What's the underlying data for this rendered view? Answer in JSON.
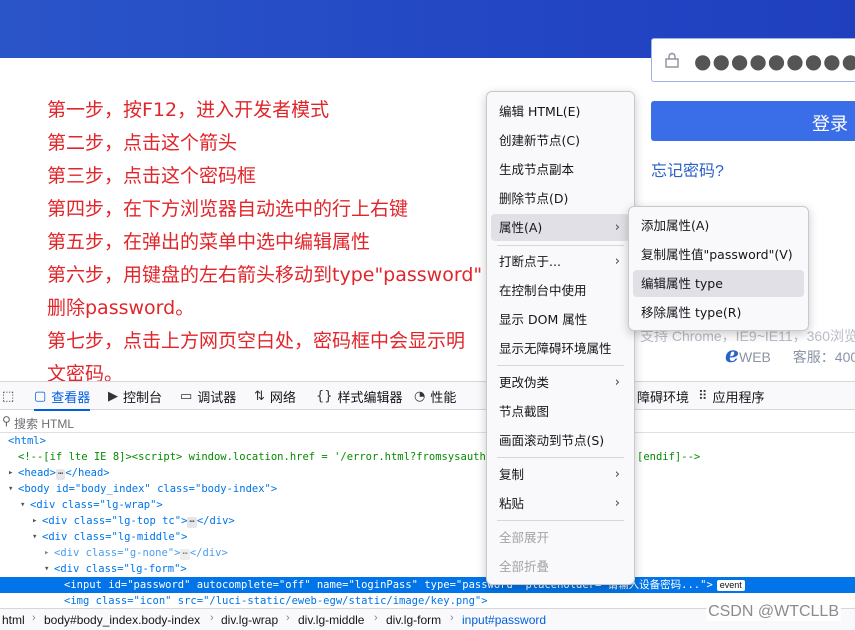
{
  "page": {
    "password_dots": "●●●●●●●●●●",
    "login_label": "登录",
    "forgot_label": "忘记密码?",
    "steps": [
      "第一步，按F12，进入开发者模式",
      "第二步，点击这个箭头",
      "第三步，点击这个密码框",
      "第四步，在下方浏览器自动选中的行上右键",
      "第五步，在弹出的菜单中选中编辑属性",
      "第六步，用键盘的左右箭头移动到type\"password\"",
      "删除password。",
      "第七步，点击上方网页空白处，密码框中会显示明",
      "文密码。"
    ],
    "support_text": "支持 Chrome，IE9~IE11，360浏览",
    "eweb_logo": "e",
    "eweb_text": "WEB",
    "service_text": "客服：",
    "service_num": "400"
  },
  "devtools": {
    "tabs": [
      {
        "icon": "▢",
        "label": "查看器"
      },
      {
        "icon": "▶",
        "label": "控制台"
      },
      {
        "icon": "▭",
        "label": "调试器"
      },
      {
        "icon": "⇅",
        "label": "网络"
      },
      {
        "icon": "{}",
        "label": "样式编辑器"
      },
      {
        "icon": "◔",
        "label": "性能"
      },
      {
        "icon": "",
        "label": "障碍环境"
      },
      {
        "icon": "⠿",
        "label": "应用程序"
      }
    ],
    "search_placeholder": "搜索 HTML",
    "tree": [
      "<html>",
      "<!--[if lte IE 8]><script> window.location.href = '/error.html?fromsysauth' + ",
      "[endif]-->",
      "<head>",
      "</head>",
      "<body id=\"body_index\" class=\"body-index\">",
      "<div class=\"lg-wrap\">",
      "<div class=\"lg-top tc\">",
      "</div>",
      "<div class=\"lg-middle\">",
      "<div class=\"g-none\">",
      "</div>",
      "<div class=\"lg-form\">",
      "<input id=\"password\" autocomplete=\"off\" name=\"loginPass\" type=\"password\" placeholder=\"请输入设备密码...\">",
      "event",
      "<img class=\"icon\" src=\"/luci-static/eweb-egw/static/image/key.png\">"
    ],
    "breadcrumb": [
      "html",
      "body#body_index.body-index",
      "div.lg-wrap",
      "div.lg-middle",
      "div.lg-form",
      "input#password"
    ]
  },
  "context_menu": {
    "items": [
      "编辑 HTML(E)",
      "创建新节点(C)",
      "生成节点副本",
      "删除节点(D)",
      "属性(A)",
      "打断点于...",
      "在控制台中使用",
      "显示 DOM 属性",
      "显示无障碍环境属性",
      "更改伪类",
      "节点截图",
      "画面滚动到节点(S)",
      "复制",
      "粘贴",
      "全部展开",
      "全部折叠"
    ]
  },
  "submenu": {
    "items": [
      "添加属性(A)",
      "复制属性值\"password\"(V)",
      "编辑属性 type",
      "移除属性 type(R)"
    ]
  },
  "watermark": "CSDN @WTCLLB",
  "colors": {
    "banner": "#2346c4",
    "step_text": "#e0262b",
    "login_button": "#3a6ee8",
    "devtools_accent": "#0060df",
    "selected_row": "#0074e8"
  }
}
